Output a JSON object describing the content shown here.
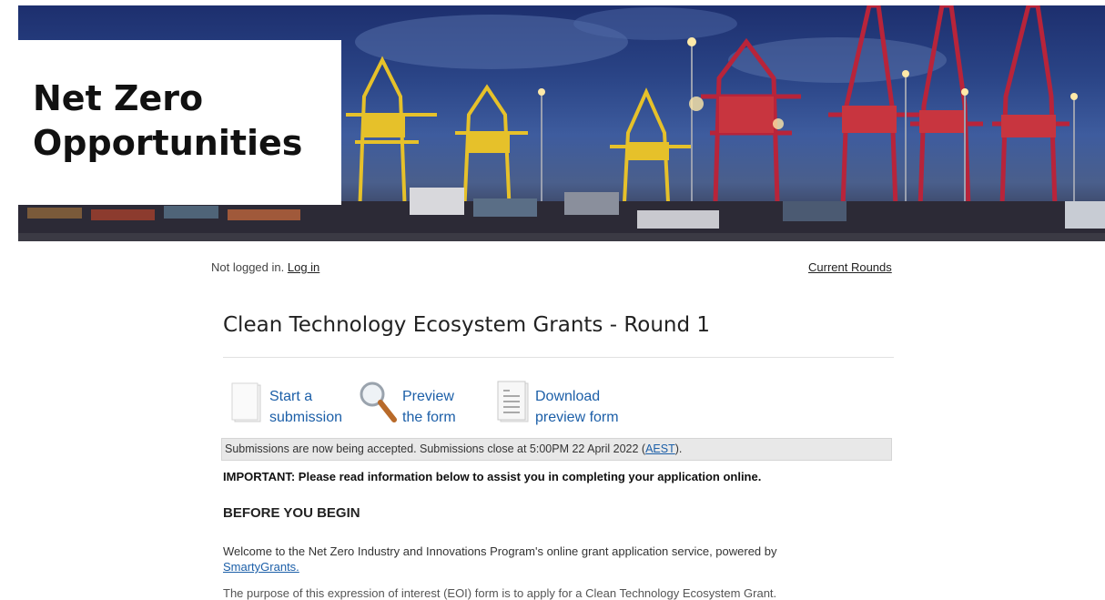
{
  "banner": {
    "title_line1": "Net Zero",
    "title_line2": "Opportunities"
  },
  "login": {
    "status_text": "Not logged in.",
    "login_link": "Log in"
  },
  "nav": {
    "current_rounds": "Current Rounds"
  },
  "page": {
    "title": "Clean Technology Ecosystem Grants - Round 1"
  },
  "actions": {
    "start_line1": "Start a",
    "start_line2": "submission",
    "preview_line1": "Preview",
    "preview_line2": "the form",
    "download_line1": "Download",
    "download_line2": "preview form"
  },
  "status": {
    "text": "Submissions are now being accepted. Submissions close at 5:00PM 22 April 2022 (",
    "tz_link": "AEST",
    "suffix": ")."
  },
  "important": "IMPORTANT: Please read information below to assist you in completing your application online.",
  "before": {
    "heading": "BEFORE YOU BEGIN",
    "text": "Welcome to the Net Zero Industry and Innovations Program's online grant application service, powered by",
    "link": "SmartyGrants.",
    "cutoff": "The purpose of this expression of interest (EOI) form is to apply for a Clean Technology Ecosystem Grant."
  },
  "colors": {
    "link_blue": "#1c5fa8",
    "banner_sky": "#2a4486",
    "crane_yellow": "#e6c12a",
    "crane_red": "#b8243a"
  }
}
